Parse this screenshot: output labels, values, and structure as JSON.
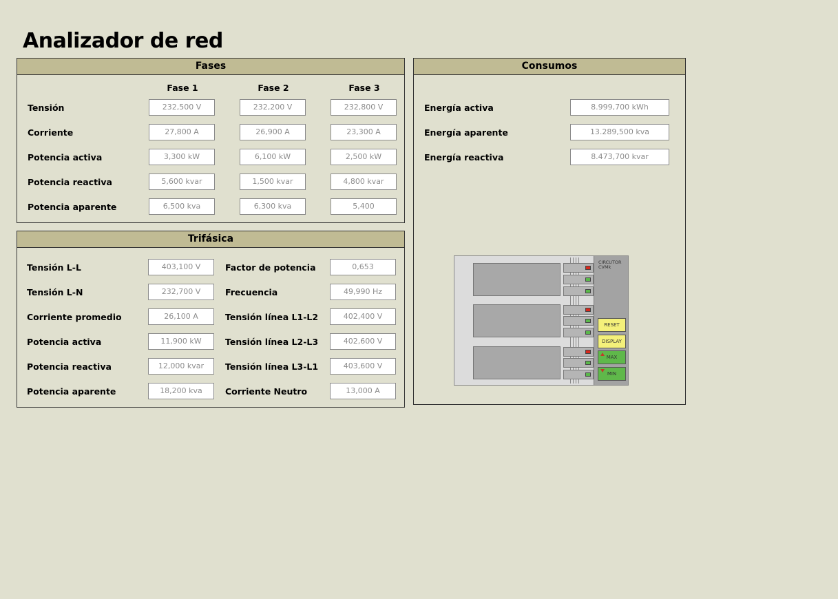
{
  "page": {
    "title": "Analizador de red"
  },
  "fases": {
    "title": "Fases",
    "columns": [
      "Fase 1",
      "Fase 2",
      "Fase 3"
    ],
    "rows": [
      {
        "label": "Tensión",
        "values": [
          "232,500 V",
          "232,200 V",
          "232,800 V"
        ]
      },
      {
        "label": "Corriente",
        "values": [
          "27,800 A",
          "26,900 A",
          "23,300 A"
        ]
      },
      {
        "label": "Potencia activa",
        "values": [
          "3,300 kW",
          "6,100 kW",
          "2,500 kW"
        ]
      },
      {
        "label": "Potencia reactiva",
        "values": [
          "5,600 kvar",
          "1,500 kvar",
          "4,800 kvar"
        ]
      },
      {
        "label": "Potencia aparente",
        "values": [
          "6,500 kva",
          "6,300 kva",
          "5,400"
        ]
      }
    ]
  },
  "trifasica": {
    "title": "Trifásica",
    "left": [
      {
        "label": "Tensión L-L",
        "value": "403,100 V"
      },
      {
        "label": "Tensión L-N",
        "value": "232,700 V"
      },
      {
        "label": "Corriente promedio",
        "value": "26,100 A"
      },
      {
        "label": "Potencia activa",
        "value": "11,900 kW"
      },
      {
        "label": "Potencia reactiva",
        "value": "12,000 kvar"
      },
      {
        "label": "Potencia aparente",
        "value": "18,200 kva"
      }
    ],
    "right": [
      {
        "label": "Factor de potencia",
        "value": "0,653"
      },
      {
        "label": "Frecuencia",
        "value": "49,990 Hz"
      },
      {
        "label": "Tensión línea L1-L2",
        "value": "402,400 V"
      },
      {
        "label": "Tensión línea L2-L3",
        "value": "402,600 V"
      },
      {
        "label": "Tensión línea L3-L1",
        "value": "403,600 V"
      },
      {
        "label": "Corriente Neutro",
        "value": "13,000 A"
      }
    ]
  },
  "consumos": {
    "title": "Consumos",
    "rows": [
      {
        "label": "Energía activa",
        "value": "8.999,700 kWh"
      },
      {
        "label": "Energía aparente",
        "value": "13.289,500 kva"
      },
      {
        "label": "Energía reactiva",
        "value": "8.473,700 kvar"
      }
    ]
  },
  "device": {
    "brand": "CIRCUTOR\nCVMk",
    "buttons": [
      "RESET",
      "DISPLAY",
      "MAX",
      "MIN"
    ],
    "led_colors": {
      "red": "#d8281c",
      "green": "#5ab84a"
    }
  }
}
